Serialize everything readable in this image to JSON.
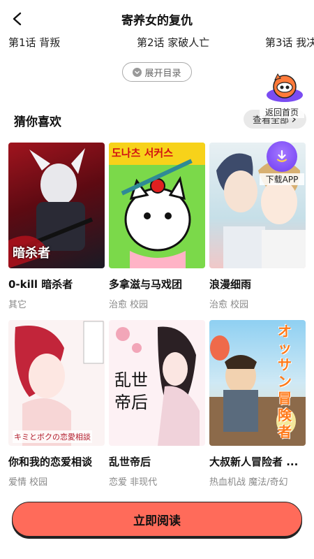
{
  "header": {
    "title": "寄养女的复仇"
  },
  "chapters": [
    {
      "label": "第1话 背叛"
    },
    {
      "label": "第2话 家破人亡"
    },
    {
      "label": "第3话 我决"
    }
  ],
  "expand_label": "展开目录",
  "recommend": {
    "title": "猜你喜欢",
    "see_all": "查看全部",
    "items": [
      {
        "title": "0-kill 暗杀者",
        "tags": "其它",
        "cover_text": "暗杀者"
      },
      {
        "title": "多拿滋与马戏团",
        "tags": "治愈 校园",
        "cover_text": "도나츠 서커스"
      },
      {
        "title": "浪漫细雨",
        "tags": "治愈 校园"
      },
      {
        "title": "你和我的恋爱相谈",
        "tags": "爱情 校园",
        "cover_text": "キミとボクの恋愛相談"
      },
      {
        "title": "乱世帝后",
        "tags": "恋爱 非现代",
        "cover_text": "乱世帝后"
      },
      {
        "title": "大叔新人冒险者 ...",
        "tags": "热血机战 魔法/奇幻",
        "cover_text": "オッサン冒険者"
      }
    ]
  },
  "float_home_label": "返回首页",
  "float_download_label": "下载APP",
  "read_button": "立即阅读",
  "colors": {
    "accent": "#ff6b5a",
    "download": "#7b4bf5"
  }
}
